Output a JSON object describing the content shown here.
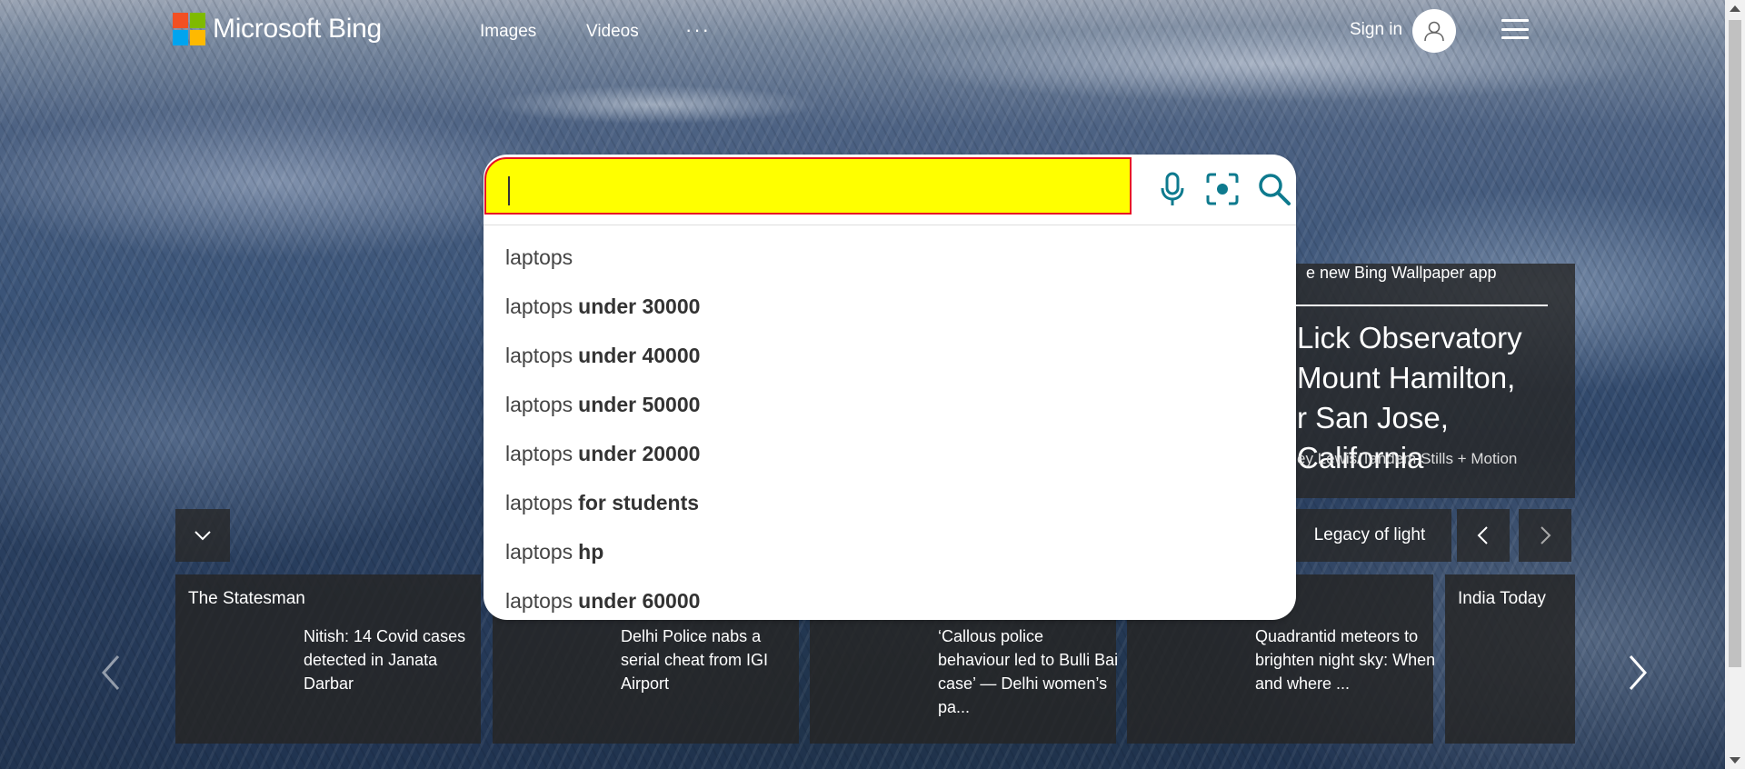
{
  "header": {
    "brand": "Microsoft Bing",
    "nav": [
      "Images",
      "Videos"
    ],
    "more": "···",
    "signin": "Sign in"
  },
  "colors": {
    "logo": [
      "#f25022",
      "#7fba00",
      "#00a4ef",
      "#ffb900"
    ],
    "search_highlight": "#ffff00",
    "search_border": "#e81123",
    "icon_accent": "#0e7a8e"
  },
  "search": {
    "value": "",
    "suggestions": [
      {
        "base": "laptops",
        "bold": ""
      },
      {
        "base": "laptops",
        "bold": "under 30000"
      },
      {
        "base": "laptops",
        "bold": "under 40000"
      },
      {
        "base": "laptops",
        "bold": "under 50000"
      },
      {
        "base": "laptops",
        "bold": "under 20000"
      },
      {
        "base": "laptops",
        "bold": "for students"
      },
      {
        "base": "laptops",
        "bold": "hp"
      },
      {
        "base": "laptops",
        "bold": "under 60000"
      }
    ],
    "icons": [
      "microphone-icon",
      "visual-search-icon",
      "search-icon"
    ]
  },
  "wallpaper": {
    "app_text": "e new Bing Wallpaper app",
    "title": "Lick Observatory Mount Hamilton, r San Jose, California",
    "title_lines": [
      "Lick Observatory",
      "Mount Hamilton,",
      "r San Jose, California"
    ],
    "credit": "ey Lewis/Tandem Stills + Motion",
    "legacy": "Legacy of light"
  },
  "news": [
    {
      "source": "The Statesman",
      "headline": "Nitish: 14 Covid cases detected in Janata Darbar"
    },
    {
      "source": "",
      "headline": "Delhi Police nabs a serial cheat from IGI Airport"
    },
    {
      "source": "",
      "headline": "‘Callous police behaviour led to Bulli Bai case’ — Delhi women’s pa..."
    },
    {
      "source": "",
      "headline": "Quadrantid meteors to brighten night sky: When and where ..."
    },
    {
      "source": "India Today",
      "headline": ""
    }
  ]
}
